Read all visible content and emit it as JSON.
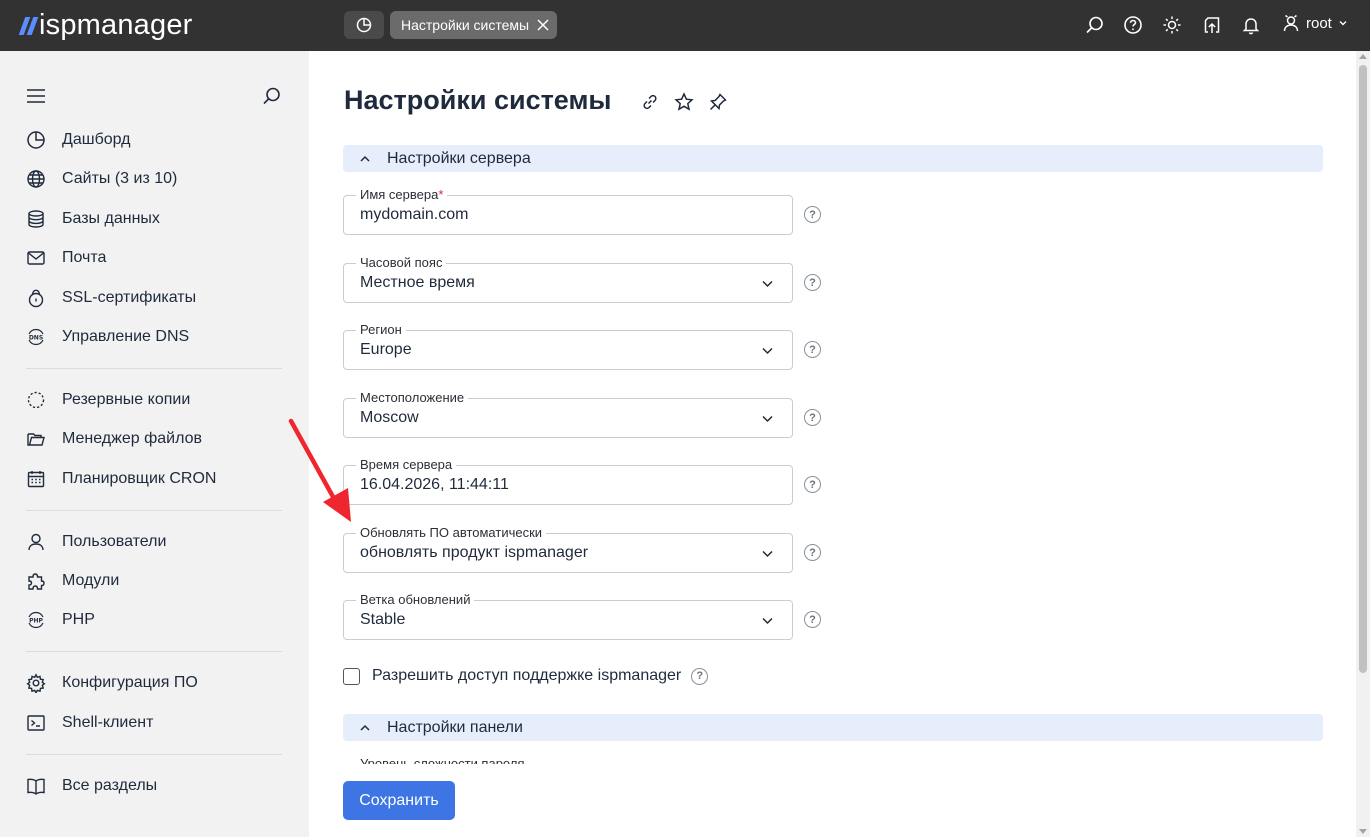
{
  "header": {
    "logo_text": "ispmanager",
    "active_tab": "Настройки системы",
    "user_name": "root"
  },
  "sidebar": {
    "groups": [
      [
        {
          "label": "Дашборд",
          "icon": "dashboard-icon"
        },
        {
          "label": "Сайты (3 из 10)",
          "icon": "globe-icon"
        },
        {
          "label": "Базы данных",
          "icon": "database-icon"
        },
        {
          "label": "Почта",
          "icon": "mail-icon"
        },
        {
          "label": "SSL-сертификаты",
          "icon": "lock-icon"
        },
        {
          "label": "Управление DNS",
          "icon": "dns-icon"
        }
      ],
      [
        {
          "label": "Резервные копии",
          "icon": "backup-icon"
        },
        {
          "label": "Менеджер файлов",
          "icon": "folder-icon"
        },
        {
          "label": "Планировщик CRON",
          "icon": "calendar-icon"
        }
      ],
      [
        {
          "label": "Пользователи",
          "icon": "user-icon"
        },
        {
          "label": "Модули",
          "icon": "puzzle-icon"
        },
        {
          "label": "PHP",
          "icon": "php-icon"
        }
      ],
      [
        {
          "label": "Конфигурация ПО",
          "icon": "gear-icon"
        },
        {
          "label": "Shell-клиент",
          "icon": "terminal-icon"
        }
      ],
      [
        {
          "label": "Все разделы",
          "icon": "book-icon"
        }
      ]
    ]
  },
  "main": {
    "title": "Настройки системы",
    "section_server": "Настройки сервера",
    "fields": [
      {
        "label": "Имя сервера",
        "required": "*",
        "value": "mydomain.com",
        "type": "input"
      },
      {
        "label": "Часовой пояс",
        "value": "Местное время",
        "type": "select"
      },
      {
        "label": "Регион",
        "value": "Europe",
        "type": "select"
      },
      {
        "label": "Местоположение",
        "value": "Moscow",
        "type": "select"
      },
      {
        "label": "Время сервера",
        "value": "16.04.2026, 11:44:11",
        "type": "input"
      },
      {
        "label": "Обновлять ПО автоматически",
        "value": "обновлять продукт ispmanager",
        "type": "select"
      },
      {
        "label": "Ветка обновлений",
        "value": "Stable",
        "type": "select"
      }
    ],
    "checkbox_label": "Разрешить доступ поддержке ispmanager",
    "section_panel": "Настройки панели",
    "partial_label": "Уровень сложности пароля",
    "help_glyph": "?",
    "save_label": "Сохранить"
  },
  "colors": {
    "topbar": "#323232",
    "accent": "#3d75e4",
    "section_bg": "#e6edfb",
    "arrow": "#f0262e"
  }
}
